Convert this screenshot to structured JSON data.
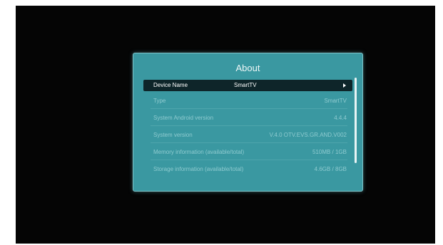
{
  "dialog": {
    "title": "About",
    "rows": [
      {
        "label": "Device Name",
        "value": "SmartTV"
      },
      {
        "label": "Type",
        "value": "SmartTV"
      },
      {
        "label": "System Android version",
        "value": "4.4.4"
      },
      {
        "label": "System version",
        "value": "V.4.0 OTV.EVS.GR.AND.V002"
      },
      {
        "label": "Memory information (available/total)",
        "value": "510MB / 1GB"
      },
      {
        "label": "Storage information (available/total)",
        "value": "4.6GB / 8GB"
      }
    ]
  },
  "colors": {
    "screen_bg": "#050505",
    "dialog_bg": "#3a98a1",
    "selected_row_bg": "#0e2529",
    "dim_text": "#8fcbd0"
  },
  "icons": {
    "selected_row_indicator": "chevron-right-icon"
  }
}
